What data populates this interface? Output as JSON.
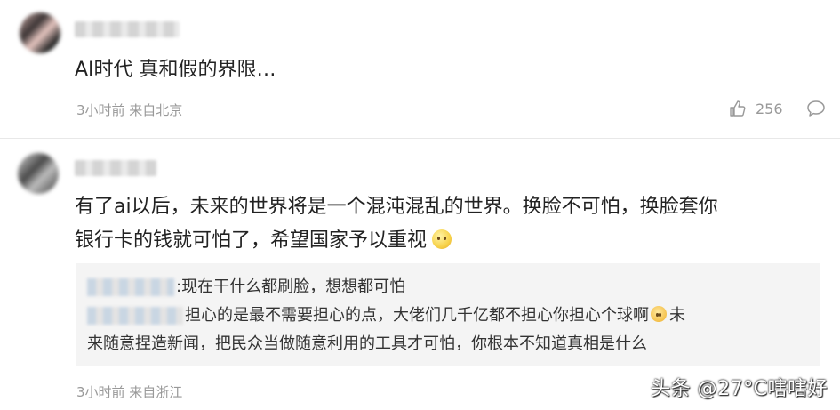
{
  "comments": [
    {
      "text": "AI时代 真和假的界限…",
      "meta": "3小时前 来自北京",
      "likes": "256"
    },
    {
      "text_line1": "有了ai以后，未来的世界将是一个混沌混乱的世界。换脸不可怕，换脸套你",
      "text_line2": "银行卡的钱就可怕了，希望国家予以重视",
      "replies": [
        {
          "text": ":现在干什么都刷脸，想想都可怕"
        },
        {
          "text_part1": "担心的是最不需要担心的点，大佬们几千亿都不担心你担心个球啊",
          "text_part2": "未"
        },
        {
          "text": "来随意捏造新闻，把民众当做随意利用的工具才可怕，你根本不知道真相是什么"
        }
      ],
      "meta": "3小时前 来自浙江"
    }
  ],
  "watermark": "头条 @27°C嗐嗐好",
  "icons": {
    "like": "thumbs-up-icon",
    "reply": "comment-bubble-icon",
    "emoji": "smiley-emoji-icon"
  }
}
